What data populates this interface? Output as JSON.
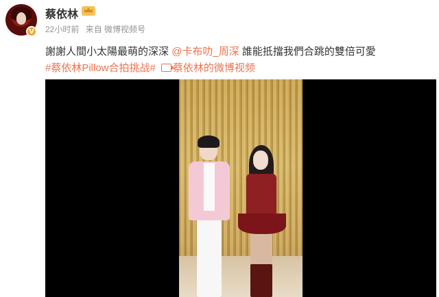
{
  "user": {
    "name": "蔡依林",
    "verify_badge": "V",
    "avatar_icon": "avatar-icon",
    "member_icon": "crown-badge-icon"
  },
  "meta": {
    "time": "22小时前",
    "source": "来自 微博视频号"
  },
  "post": {
    "text_before": "謝謝人間小太陽最萌的深深 ",
    "mention": "@卡布叻_周深",
    "text_after": " 誰能抵擋我們合跳的雙倍可愛",
    "hashtag": "#蔡依林Pillow合拍挑战#",
    "video_link": "蔡依林的微博视频"
  },
  "colors": {
    "link": "#eb7350",
    "text": "#333333",
    "meta": "#939393",
    "player_bg": "#000000"
  }
}
